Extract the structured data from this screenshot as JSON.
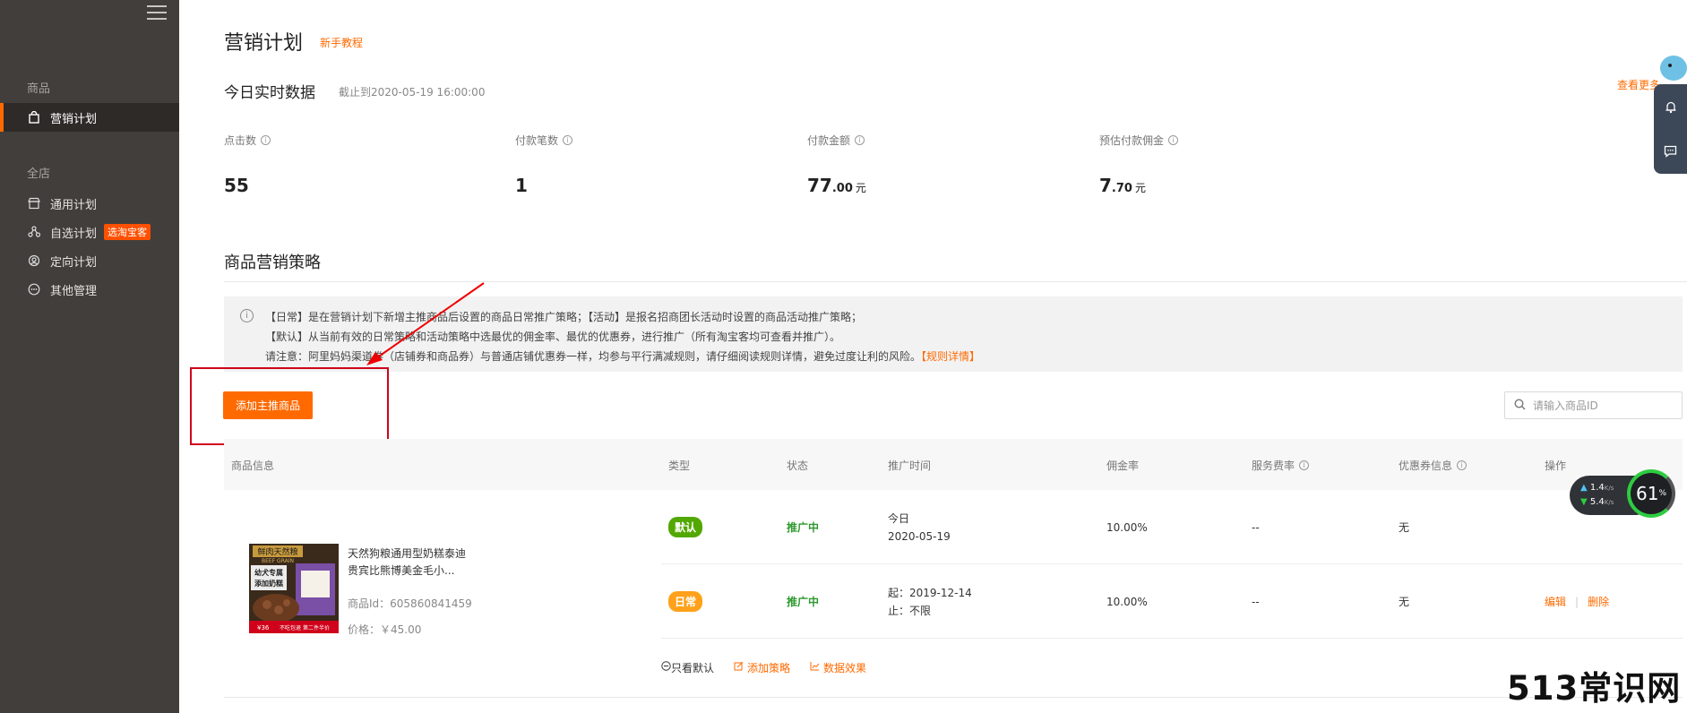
{
  "sidebar": {
    "section_goods": "商品",
    "section_store": "全店",
    "items": [
      {
        "label": "营销计划",
        "icon": "bag-icon",
        "active": true
      },
      {
        "label": "通用计划",
        "icon": "store-icon"
      },
      {
        "label": "自选计划",
        "icon": "share-nodes-icon",
        "badge": "选淘宝客"
      },
      {
        "label": "定向计划",
        "icon": "target-user-icon"
      },
      {
        "label": "其他管理",
        "icon": "more-circle-icon"
      }
    ]
  },
  "header": {
    "title": "营销计划",
    "tutorial_link": "新手教程"
  },
  "realtime": {
    "title": "今日实时数据",
    "note": "截止到2020-05-19 16:00:00",
    "more_link": "查看更多",
    "stats": [
      {
        "label": "点击数",
        "value": "55",
        "decimal": "",
        "unit": ""
      },
      {
        "label": "付款笔数",
        "value": "1",
        "decimal": "",
        "unit": ""
      },
      {
        "label": "付款金额",
        "value": "77",
        "decimal": ".00",
        "unit": "元"
      },
      {
        "label": "预估付款佣金",
        "value": "7",
        "decimal": ".70",
        "unit": "元"
      }
    ]
  },
  "strategy": {
    "title": "商品营销策略",
    "notice": {
      "line1": "【日常】是在营销计划下新增主推商品后设置的商品日常推广策略；【活动】是报名招商团长活动时设置的商品活动推广策略；",
      "line2": "【默认】从当前有效的日常策略和活动策略中选最优的佣金率、最优的优惠券，进行推广（所有淘宝客均可查看并推广）。",
      "line3": "请注意：阿里妈妈渠道券（店铺券和商品券）与普通店铺优惠券一样，均参与平行满减规则，请仔细阅读规则详情，避免过度让利的风险。",
      "line3_link": "【规则详情】"
    },
    "add_button": "添加主推商品",
    "search_placeholder": "请输入商品ID"
  },
  "table": {
    "headers": [
      "商品信息",
      "类型",
      "状态",
      "推广时间",
      "佣金率",
      "服务费率",
      "优惠券信息",
      "操作"
    ],
    "product": {
      "name": "天然狗粮通用型奶糕泰迪贵宾比熊博美金毛小...",
      "id_text": "商品Id：605860841459",
      "price_text": "价格：￥45.00",
      "image_texts": {
        "brand": "鲜肉天然粮",
        "brand_en": "BEEF GRAIN",
        "slogan1": "幼犬专属",
        "slogan2": "添加奶糕",
        "price_tag": "¥36",
        "strip": "不吃包退 第二件半价"
      }
    },
    "rows": [
      {
        "type": "默认",
        "type_color": "#52a800",
        "status": "推广中",
        "time1": "今日",
        "time2": "2020-05-19",
        "commission": "10.00%",
        "service": "--",
        "coupon": "无",
        "ops": []
      },
      {
        "type": "日常",
        "type_color": "#ffa11a",
        "status": "推广中",
        "time1": "起：2019-12-14",
        "time2": "止：不限",
        "commission": "10.00%",
        "service": "--",
        "coupon": "无",
        "ops": [
          "编辑",
          "删除"
        ]
      }
    ],
    "footer": {
      "only_default": "只看默认",
      "add_strategy": "添加策略",
      "data_effect": "数据效果"
    }
  },
  "overlay": {
    "upload_speed": "1.4",
    "download_speed": "5.4",
    "speed_unit": "K/s",
    "cpu_percent": "61",
    "percent_sign": "%",
    "watermark": "513常识网"
  },
  "colors": {
    "accent": "#ff6a00",
    "sidebar_bg": "#413e3b",
    "status_green": "#2e9a2e"
  }
}
